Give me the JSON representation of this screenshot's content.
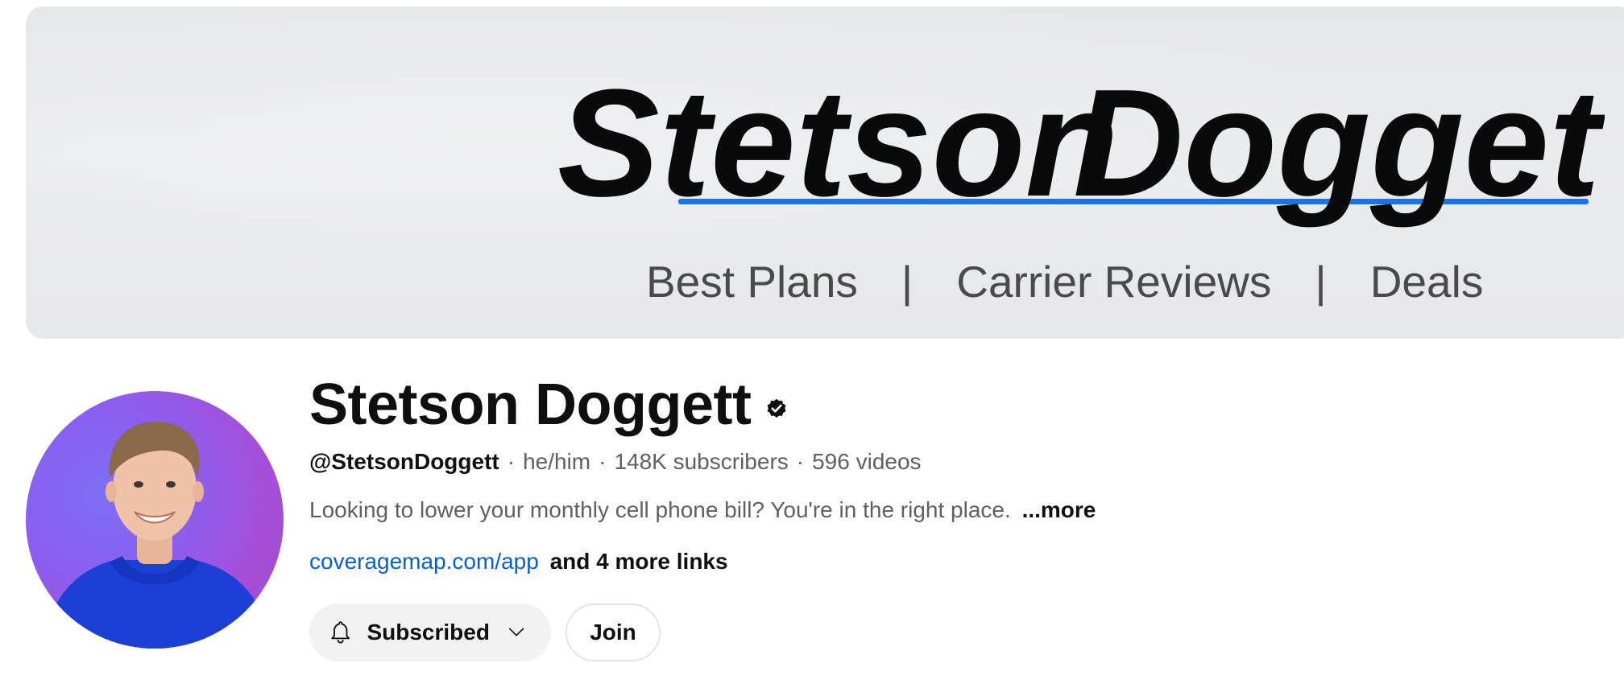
{
  "banner": {
    "logo_first": "Stetson",
    "logo_second": "Doggett",
    "tagline": [
      "Best Plans",
      "Carrier Reviews",
      "Deals"
    ],
    "separator": "|",
    "underline_color": "#1a73e8"
  },
  "channel": {
    "title": "Stetson Doggett",
    "verified_icon": "verified-check-icon",
    "handle": "@StetsonDoggett",
    "pronouns": "he/him",
    "subscribers": "148K subscribers",
    "videos": "596 videos",
    "meta_separator": "·",
    "description": "Looking to lower your monthly cell phone bill? You're in the right place.",
    "description_more": "...more",
    "link_url": "coveragemap.com/app",
    "more_links": "and 4 more links"
  },
  "actions": {
    "subscribed_label": "Subscribed",
    "join_label": "Join",
    "bell_icon": "bell-icon",
    "chevron_icon": "chevron-down-icon"
  },
  "colors": {
    "link": "#065fd4",
    "text_primary": "#0f0f0f",
    "text_secondary": "#606060",
    "button_bg": "#f2f2f2"
  }
}
